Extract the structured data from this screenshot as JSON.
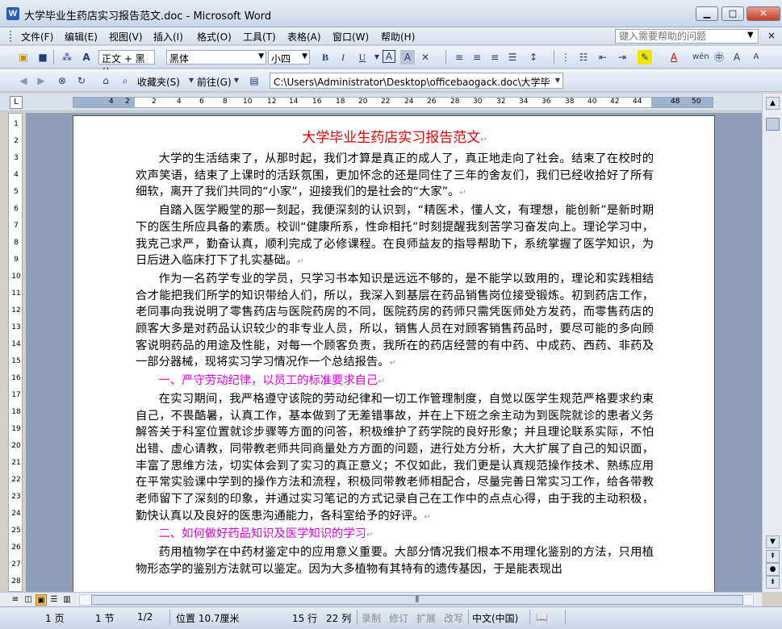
{
  "window": {
    "title": "大学毕业生药店实习报告范文.doc - Microsoft Word",
    "app_icon": "W",
    "minimize": "▁",
    "maximize": "□",
    "close": "✕"
  },
  "menubar": {
    "items": [
      "文件(F)",
      "编辑(E)",
      "视图(V)",
      "插入(I)",
      "格式(O)",
      "工具(T)",
      "表格(A)",
      "窗口(W)",
      "帮助(H)"
    ],
    "help_placeholder": "键入需要帮助的问题",
    "close_doc": "×"
  },
  "toolbar1": {
    "style_value": "正文 + 黑体",
    "font_value": "黑体",
    "size_value": "小四",
    "bold": "B",
    "italic": "I",
    "underline": "U",
    "char_border": "A",
    "char_shading": "A",
    "font_color": "A",
    "grow_font": "A",
    "shrink_font": "A"
  },
  "toolbar2": {
    "favorites": "收藏夹(S)",
    "go": "前往(G)",
    "path": "C:\\Users\\Administrator\\Desktop\\officebaogack.doc\\大学毕"
  },
  "ruler": {
    "ticks": [
      "4",
      "2",
      "2",
      "4",
      "6",
      "8",
      "10",
      "12",
      "14",
      "16",
      "18",
      "20",
      "22",
      "24",
      "26",
      "28",
      "30",
      "32",
      "34",
      "36",
      "38",
      "40",
      "42",
      "44",
      "48",
      "50"
    ],
    "tab_button": "L"
  },
  "vruler": {
    "ticks": [
      "1",
      "2",
      "3",
      "4",
      "5",
      "6",
      "7",
      "8",
      "9",
      "10",
      "11",
      "12",
      "13",
      "14",
      "15",
      "16",
      "17",
      "18",
      "19",
      "20",
      "21",
      "22",
      "23",
      "24",
      "25",
      "26",
      "27",
      "28"
    ]
  },
  "document": {
    "title": "大学毕业生药店实习报告范文",
    "paragraphs": [
      {
        "type": "body",
        "text": "大学的生活结束了，从那时起，我们才算是真正的成人了，真正地走向了社会。结束了在校时的欢声笑语，结束了上课时的活跃氛围，更加怀念的还是同住了三年的舍友们，我们已经收拾好了所有细软，离开了我们共同的“小家”，迎接我们的是社会的“大家”。"
      },
      {
        "type": "body",
        "text": "自踏入医学殿堂的那一刻起，我便深刻的认识到，“精医术，懂人文，有理想，能创新”是新时期下的医生所应具备的素质。校训“健康所系，性命相托”时刻提醒我刻苦学习奋发向上。理论学习中，我克己求严，勤奋认真，顺利完成了必修课程。在良师益友的指导帮助下，系统掌握了医学知识，为日后进入临床打下了扎实基础。"
      },
      {
        "type": "body",
        "text": "作为一名药学专业的学员，只学习书本知识是远远不够的，是不能学以致用的，理论和实践相结合才能把我们所学的知识带给人们，所以，我深入到基层在药品销售岗位接受锻炼。初到药店工作，老同事向我说明了零售药店与医院药房的不同，医院药房的药师只需凭医师处方发药，而零售药店的顾客大多是对药品认识较少的非专业人员，所以，销售人员在对顾客销售药品时，要尽可能的多向顾客说明药品的用途及性能，对每一个顾客负责，我所在的药店经营的有中药、中成药、西药、非药及一部分器械，现将实习学习情况作一个总结报告。"
      },
      {
        "type": "sub",
        "text": "一、严守劳动纪律，以员工的标准要求自己"
      },
      {
        "type": "body",
        "text": "在实习期间，我严格遵守该院的劳动纪律和一切工作管理制度，自觉以医学生规范严格要求约束自己，不畏酷暑，认真工作，基本做到了无差错事故，并在上下班之余主动为到医院就诊的患者义务解答关于科室位置就诊步骤等方面的问答，积极维护了药学院的良好形象；并且理论联系实际，不怕出错、虚心请教，同带教老师共同商量处方方面的问题，进行处方分析，大大扩展了自己的知识面，丰富了思维方法，切实体会到了实习的真正意义；不仅如此，我们更是认真规范操作技术、熟练应用在平常实验课中学到的操作方法和流程，积极同带教老师相配合，尽量完善日常实习工作，给各带教老师留下了深刻的印象，并通过实习笔记的方式记录自己在工作中的点点心得，由于我的主动积极，勤快认真以及良好的医患沟通能力，各科室给予的好评。"
      },
      {
        "type": "sub",
        "text": "二、如何做好药品知识及医学知识的学习"
      },
      {
        "type": "body",
        "text": "药用植物学在中药材鉴定中的应用意义重要。大部分情况我们根本不用理化鉴别的方法，只用植物形态学的鉴别方法就可以鉴定。因为大多植物有其特有的遗传基因，于是能表现出"
      }
    ]
  },
  "status": {
    "page": "1 页",
    "section": "1 节",
    "page_of": "1/2",
    "position": "位置 10.7厘米",
    "line": "15 行",
    "column": "22 列",
    "rec": "录制",
    "trk": "修订",
    "ext": "扩展",
    "ovr": "改写",
    "language": "中文(中国)"
  }
}
